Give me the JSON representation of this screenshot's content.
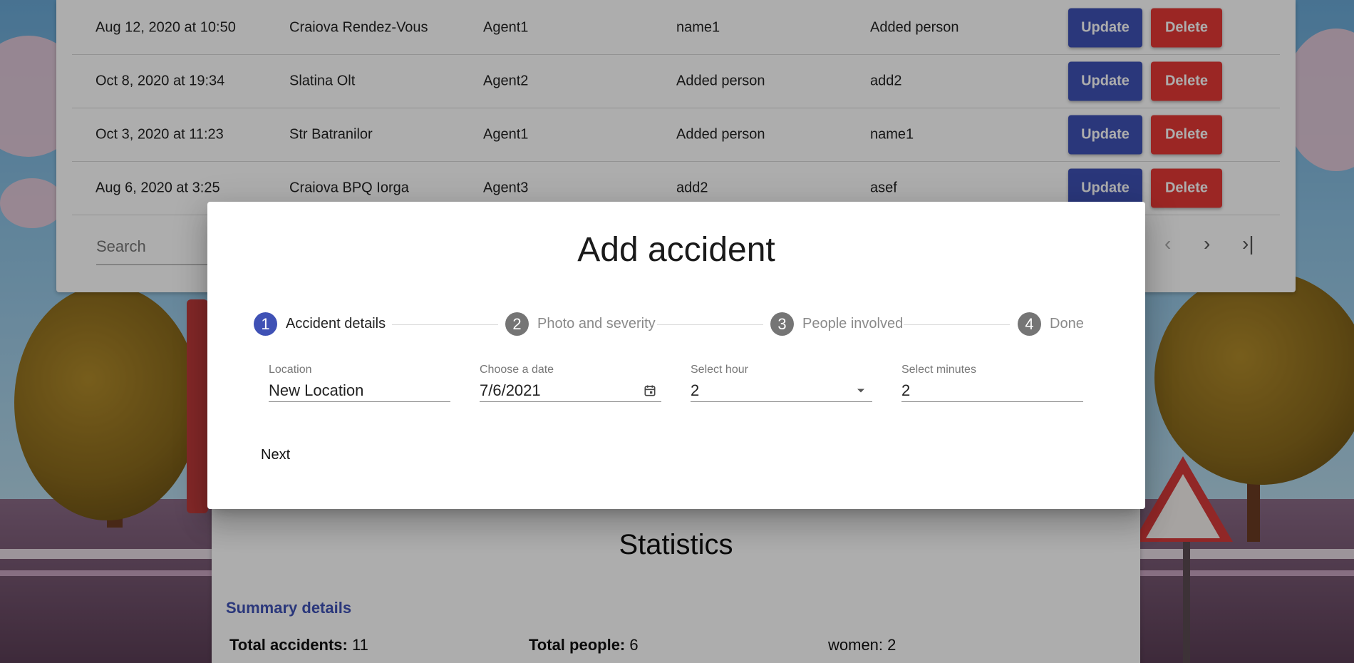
{
  "accidents_table": {
    "rows": [
      {
        "date": "Aug 12, 2020 at 10:50",
        "location": "Craiova Rendez-Vous",
        "agent": "Agent1",
        "person1": "name1",
        "person2": "Added person",
        "update_label": "Update",
        "delete_label": "Delete"
      },
      {
        "date": "Oct 8, 2020 at 19:34",
        "location": "Slatina Olt",
        "agent": "Agent2",
        "person1": "Added person",
        "person2": "add2",
        "update_label": "Update",
        "delete_label": "Delete"
      },
      {
        "date": "Oct 3, 2020 at 11:23",
        "location": "Str Batranilor",
        "agent": "Agent1",
        "person1": "Added person",
        "person2": "name1",
        "update_label": "Update",
        "delete_label": "Delete"
      },
      {
        "date": "Aug 6, 2020 at 3:25",
        "location": "Craiova BPQ Iorga",
        "agent": "Agent3",
        "person1": "add2",
        "person2": "asef",
        "update_label": "Update",
        "delete_label": "Delete"
      }
    ],
    "search": {
      "placeholder": "Search"
    },
    "pager": {
      "prev_icon": "chevron-left-icon",
      "next_icon": "chevron-right-icon",
      "last_icon": "last-page-icon"
    }
  },
  "dialog": {
    "title": "Add accident",
    "steps": [
      {
        "number": "1",
        "label": "Accident details",
        "state": "active"
      },
      {
        "number": "2",
        "label": "Photo and severity",
        "state": "inactive"
      },
      {
        "number": "3",
        "label": "People involved",
        "state": "inactive"
      },
      {
        "number": "4",
        "label": "Done",
        "state": "inactive"
      }
    ],
    "fields": {
      "location": {
        "label": "Location",
        "value": "New Location"
      },
      "date": {
        "label": "Choose a date",
        "value": "7/6/2021",
        "icon": "calendar-icon"
      },
      "hour": {
        "label": "Select hour",
        "value": "2",
        "icon": "dropdown-arrow-icon"
      },
      "minutes": {
        "label": "Select minutes",
        "value": "2"
      }
    },
    "next_label": "Next"
  },
  "statistics": {
    "title": "Statistics",
    "summary_link": "Summary details",
    "total_accidents_label": "Total accidents:",
    "total_accidents_value": "11",
    "total_people_label": "Total people:",
    "total_people_value": "6",
    "women_text": "women: 2"
  },
  "colors": {
    "primary": "#3f51b5",
    "danger": "#e53935",
    "step_inactive": "#757575"
  }
}
